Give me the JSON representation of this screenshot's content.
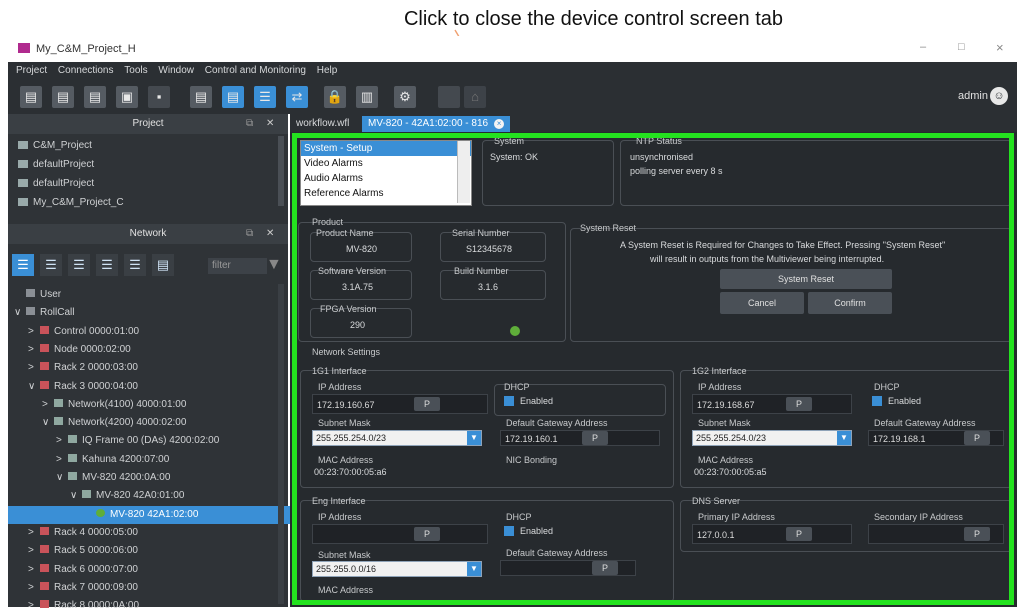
{
  "callout": "Click to close the device control screen tab",
  "window_title": "My_C&M_Project_H",
  "window_controls": {
    "minimize": "–",
    "maximize": "□",
    "close": "×"
  },
  "menu": [
    "Project",
    "Connections",
    "Tools",
    "Window",
    "Control and Monitoring",
    "Help"
  ],
  "toolbar": {
    "user": "admin"
  },
  "project_panel": {
    "title": "Project",
    "items": [
      "C&M_Project",
      "defaultProject",
      "defaultProject",
      "My_C&M_Project_C"
    ]
  },
  "network_panel": {
    "title": "Network",
    "filter_placeholder": "filter"
  },
  "tree": [
    {
      "label": "User",
      "indent": 0,
      "arrow": ""
    },
    {
      "label": "RollCall",
      "indent": 0,
      "arrow": "∨"
    },
    {
      "label": "Control 0000:01:00",
      "indent": 1,
      "arrow": ">"
    },
    {
      "label": "Node 0000:02:00",
      "indent": 1,
      "arrow": ">"
    },
    {
      "label": "Rack 2 0000:03:00",
      "indent": 1,
      "arrow": ">"
    },
    {
      "label": "Rack 3 0000:04:00",
      "indent": 1,
      "arrow": "∨"
    },
    {
      "label": "Network(4100) 4000:01:00",
      "indent": 2,
      "arrow": ">"
    },
    {
      "label": "Network(4200) 4000:02:00",
      "indent": 2,
      "arrow": "∨"
    },
    {
      "label": "IQ Frame 00 (DAs) 4200:02:00",
      "indent": 3,
      "arrow": ">"
    },
    {
      "label": "Kahuna 4200:07:00",
      "indent": 3,
      "arrow": ">"
    },
    {
      "label": "MV-820 4200:0A:00",
      "indent": 3,
      "arrow": "∨"
    },
    {
      "label": "MV-820 42A0:01:00",
      "indent": 4,
      "arrow": "∨"
    },
    {
      "label": "MV-820 42A1:02:00",
      "indent": 5,
      "arrow": "",
      "selected": true
    },
    {
      "label": "Rack 4 0000:05:00",
      "indent": 1,
      "arrow": ">"
    },
    {
      "label": "Rack 5 0000:06:00",
      "indent": 1,
      "arrow": ">"
    },
    {
      "label": "Rack 6 0000:07:00",
      "indent": 1,
      "arrow": ">"
    },
    {
      "label": "Rack 7 0000:09:00",
      "indent": 1,
      "arrow": ">"
    },
    {
      "label": "Rack 8 0000:0A:00",
      "indent": 1,
      "arrow": ">"
    }
  ],
  "tabs": {
    "workflow": "workflow.wfl",
    "device": "MV-820 - 42A1:02:00 - 816",
    "close": "×"
  },
  "list": [
    "System - Setup",
    "Video Alarms",
    "Audio Alarms",
    "Reference Alarms"
  ],
  "system": {
    "label": "System",
    "status": "System: OK"
  },
  "ntp": {
    "label": "NTP Status",
    "line1": "unsynchronised",
    "line2": "polling server every 8 s"
  },
  "product": {
    "label": "Product",
    "name_label": "Product Name",
    "name": "MV-820",
    "serial_label": "Serial Number",
    "serial": "S12345678",
    "sw_label": "Software Version",
    "sw": "3.1A.75",
    "build_label": "Build Number",
    "build": "3.1.6",
    "fpga_label": "FPGA Version",
    "fpga": "290"
  },
  "reset": {
    "label": "System Reset",
    "text1": "A System Reset is Required for Changes to Take Effect. Pressing \"System Reset\"",
    "text2": "will result in outputs from the Multiviewer being interrupted.",
    "button": "System Reset",
    "cancel": "Cancel",
    "confirm": "Confirm"
  },
  "network": {
    "label": "Network Settings",
    "p": "P",
    "g1": {
      "label": "1G1 Interface",
      "ip_label": "IP Address",
      "ip": "172.19.160.67",
      "dhcp_label": "DHCP",
      "dhcp": "Enabled",
      "mask_label": "Subnet Mask",
      "mask": "255.255.254.0/23",
      "gw_label": "Default Gateway Address",
      "gw": "172.19.160.1",
      "mac_label": "MAC Address",
      "mac": "00:23:70:00:05:a6",
      "nic_label": "NIC Bonding"
    },
    "g2": {
      "label": "1G2 Interface",
      "ip_label": "IP Address",
      "ip": "172.19.168.67",
      "dhcp_label": "DHCP",
      "dhcp": "Enabled",
      "mask_label": "Subnet Mask",
      "mask": "255.255.254.0/23",
      "gw_label": "Default Gateway Address",
      "gw": "172.19.168.1",
      "mac_label": "MAC Address",
      "mac": "00:23:70:00:05:a5"
    },
    "eng": {
      "label": "Eng Interface",
      "ip_label": "IP Address",
      "ip": "",
      "dhcp_label": "DHCP",
      "dhcp": "Enabled",
      "mask_label": "Subnet Mask",
      "mask": "255.255.0.0/16",
      "gw_label": "Default Gateway Address",
      "gw": "",
      "mac_label": "MAC Address"
    },
    "dns": {
      "label": "DNS Server",
      "primary_label": "Primary IP Address",
      "primary": "127.0.0.1",
      "secondary_label": "Secondary IP Address",
      "secondary": ""
    }
  },
  "colors": {
    "accent": "#3a8fd6",
    "highlight": "#24e21f",
    "callout_line": "#f0a070",
    "status_led": "#5fae3a"
  }
}
